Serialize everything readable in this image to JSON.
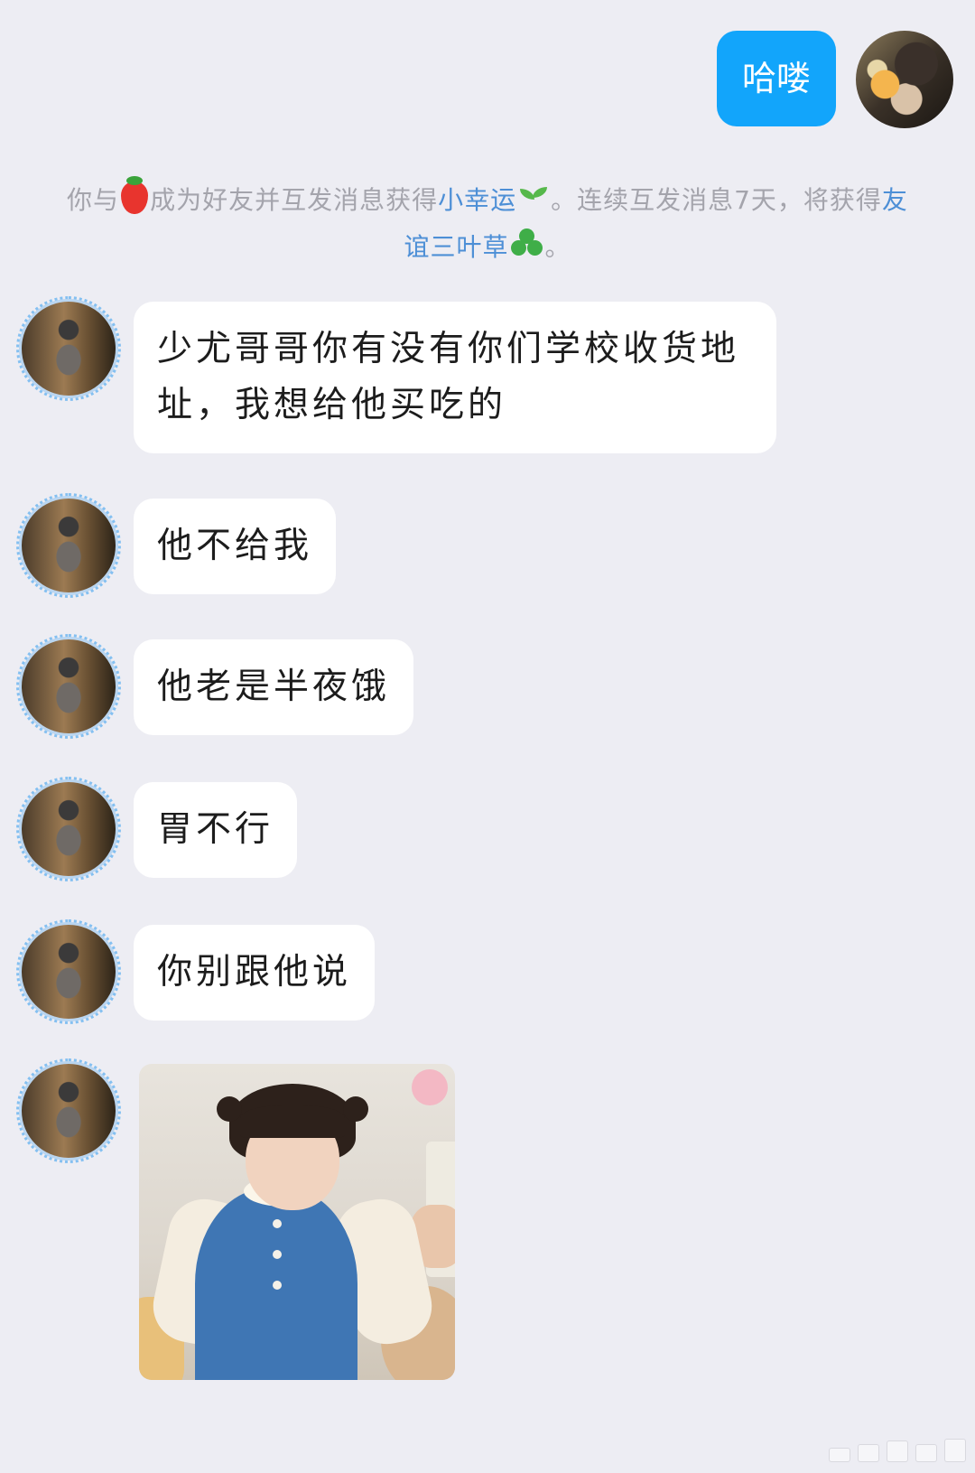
{
  "chat": {
    "outgoing": {
      "text": "哈喽"
    },
    "notice": {
      "part1": "你与",
      "part2": "成为好友并互发消息获得",
      "link1": "小幸运",
      "part3": "。连续互发消息7天，将获得",
      "link2": "友谊三叶草",
      "part4": "。"
    },
    "incoming": [
      {
        "text": "少尤哥哥你有没有你们学校收货地址，我想给他买吃的"
      },
      {
        "text": "他不给我"
      },
      {
        "text": "他老是半夜饿"
      },
      {
        "text": "胃不行"
      },
      {
        "text": "你别跟他说"
      }
    ]
  }
}
